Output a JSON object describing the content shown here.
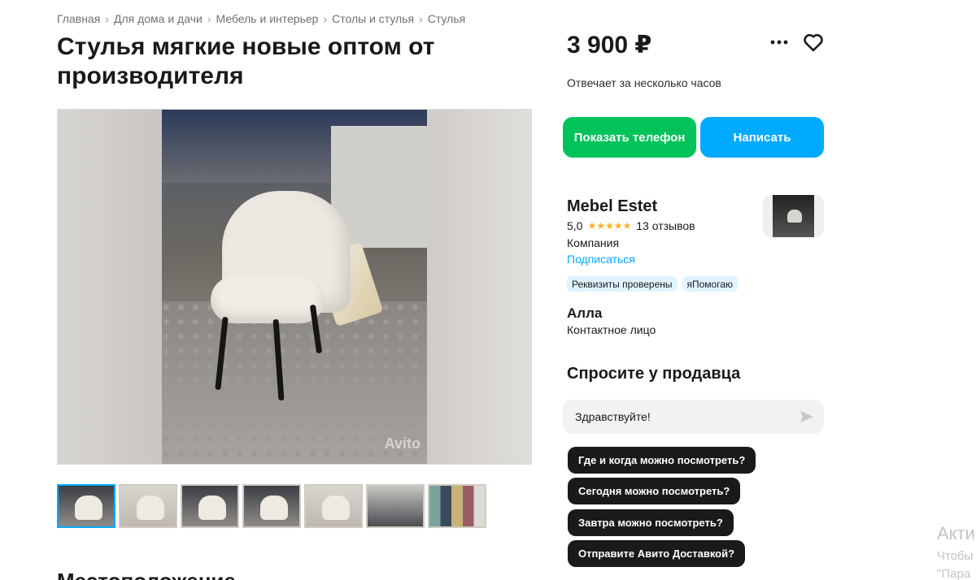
{
  "breadcrumb": [
    "Главная",
    "Для дома и дачи",
    "Мебель и интерьер",
    "Столы и стулья",
    "Стулья"
  ],
  "breadcrumb_separator": "›",
  "title": "Стулья мягкие новые оптом от производителя",
  "price": "3 900 ₽",
  "response_time": "Отвечает за несколько часов",
  "buttons": {
    "phone": "Показать телефон",
    "write": "Написать"
  },
  "colors": {
    "phone_button": "#02c35a",
    "write_button": "#00aaff",
    "link": "#00aaff",
    "stars": "#ffb021",
    "badge_bg": "#dff4ff"
  },
  "gallery": {
    "watermark": "Avito",
    "thumbnail_count": 7
  },
  "seller": {
    "name": "Mebel Estet",
    "rating": "5,0",
    "stars": "★★★★★",
    "reviews": "13 отзывов",
    "type": "Компания",
    "subscribe": "Подписаться",
    "badges": [
      "Реквизиты проверены",
      "яПомогаю"
    ]
  },
  "contact": {
    "name": "Алла",
    "role": "Контактное лицо"
  },
  "ask": {
    "title": "Спросите у продавца",
    "input_value": "Здравствуйте!",
    "quick_replies": [
      "Где и когда можно посмотреть?",
      "Сегодня можно посмотреть?",
      "Завтра можно посмотреть?",
      "Отправите Авито Доставкой?"
    ]
  },
  "location_title": "Местоположение",
  "os_watermark": {
    "line1": "Акти",
    "line2": "Чтобы",
    "line3": "\"Пара"
  }
}
